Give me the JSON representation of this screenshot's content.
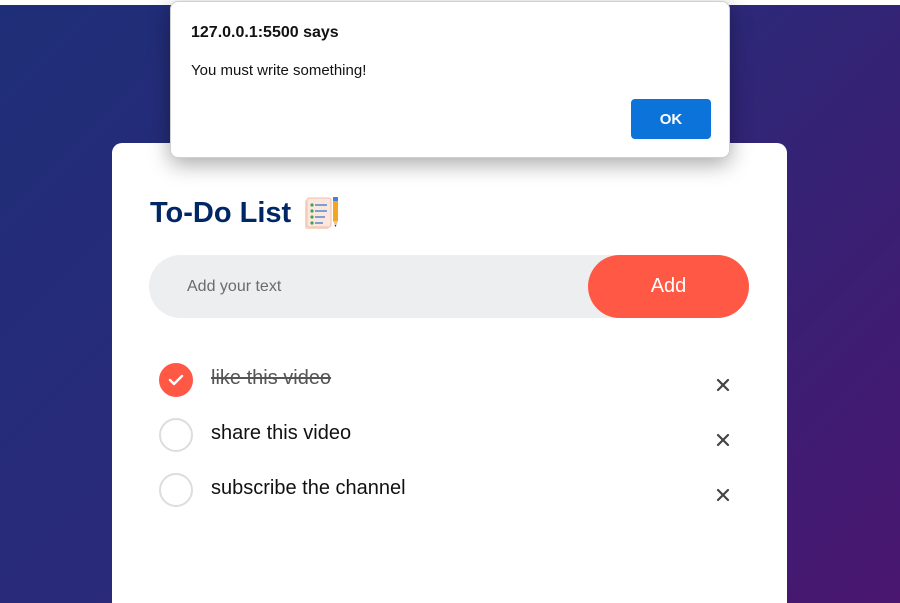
{
  "page": {
    "background_gradient": [
      "#1f2e78",
      "#4a1670"
    ]
  },
  "card": {
    "title": "To-Do List",
    "title_icon": "notepad-with-pencil-icon"
  },
  "input": {
    "placeholder": "Add your text",
    "value": "",
    "add_label": "Add",
    "add_color": "#ff5945"
  },
  "tasks": [
    {
      "text": "like this video",
      "checked": true
    },
    {
      "text": "share this video",
      "checked": false
    },
    {
      "text": "subscribe the channel",
      "checked": false
    }
  ],
  "icons": {
    "delete": "close-icon",
    "check": "checkmark-icon"
  },
  "alert": {
    "origin": "127.0.0.1:5500 says",
    "message": "You must write something!",
    "ok_label": "OK",
    "ok_color": "#0b73d9"
  }
}
